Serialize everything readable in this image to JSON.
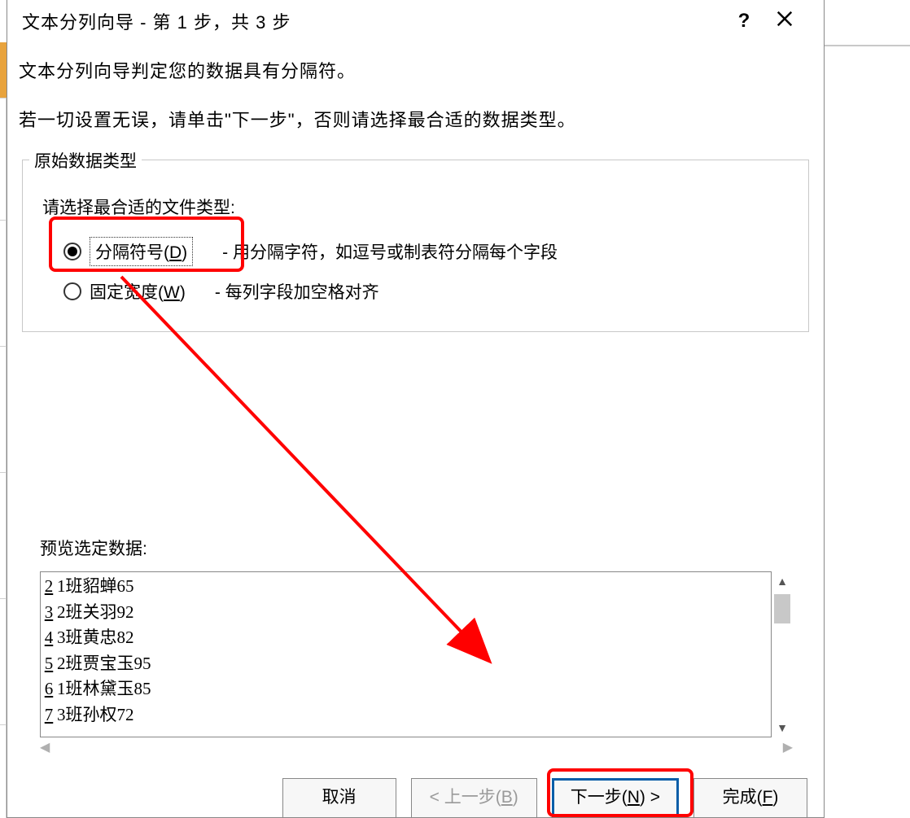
{
  "titlebar": {
    "title": "文本分列向导 - 第 1 步，共 3 步",
    "help": "?",
    "close_name": "close-icon"
  },
  "intro1": "文本分列向导判定您的数据具有分隔符。",
  "intro2": "若一切设置无误，请单击\"下一步\"，否则请选择最合适的数据类型。",
  "group": {
    "legend": "原始数据类型",
    "sub": "请选择最合适的文件类型:",
    "radio1": {
      "label_pre": "分隔符号(",
      "label_u": "D",
      "label_post": ")",
      "desc_dash": "- ",
      "desc": "用分隔字符，如逗号或制表符分隔每个字段",
      "checked": true
    },
    "radio2": {
      "label_pre": "固定宽度(",
      "label_u": "W",
      "label_post": ")",
      "desc_dash": "- ",
      "desc": "每列字段加空格对齐",
      "checked": false
    }
  },
  "preview": {
    "label": "预览选定数据:",
    "rows": [
      {
        "n": "2",
        "t": "1班貂蝉65"
      },
      {
        "n": "3",
        "t": "2班关羽92"
      },
      {
        "n": "4",
        "t": "3班黄忠82"
      },
      {
        "n": "5",
        "t": "2班贾宝玉95"
      },
      {
        "n": "6",
        "t": "1班林黛玉85"
      },
      {
        "n": "7",
        "t": "3班孙权72"
      }
    ]
  },
  "buttons": {
    "cancel": "取消",
    "back_pre": "< 上一步(",
    "back_u": "B",
    "back_post": ")",
    "next_pre": "下一步(",
    "next_u": "N",
    "next_post": ") >",
    "finish_pre": "完成(",
    "finish_u": "F",
    "finish_post": ")"
  }
}
